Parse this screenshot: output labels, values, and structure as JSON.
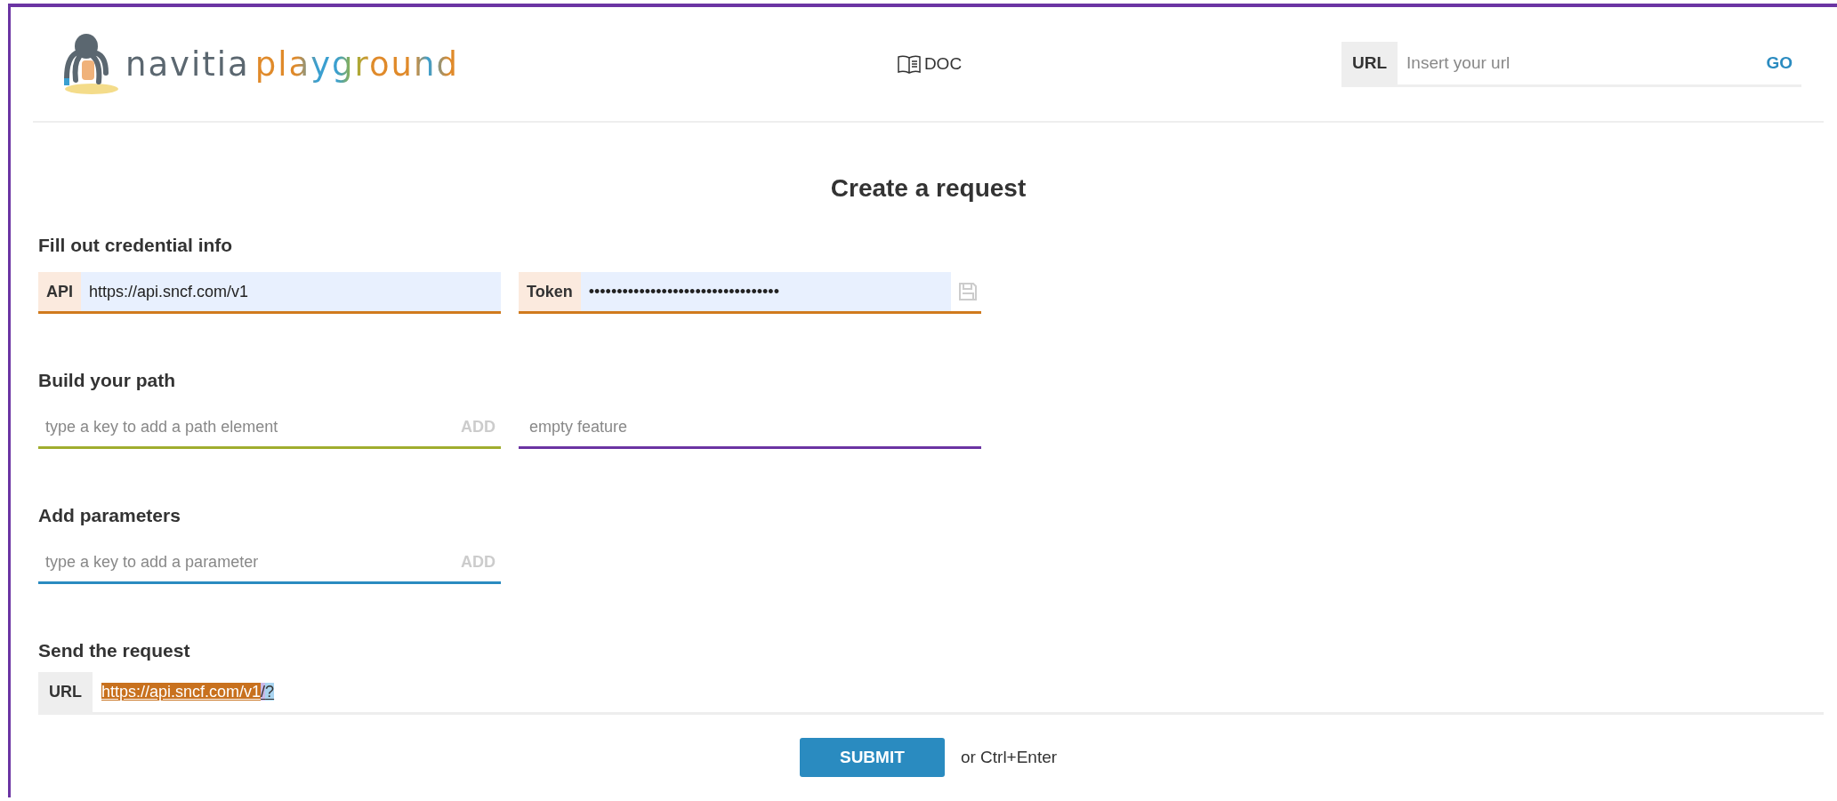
{
  "header": {
    "logo": {
      "name": "navitia",
      "accent": "playground"
    },
    "doc_link": "DOC",
    "url_bar": {
      "label": "URL",
      "placeholder": "Insert your url",
      "button": "GO"
    }
  },
  "title": "Create a request",
  "credentials": {
    "heading": "Fill out credential info",
    "api": {
      "label": "API",
      "value": "https://api.sncf.com/v1"
    },
    "token": {
      "label": "Token",
      "value": "••••••••••••••••••••••••••••••••••"
    }
  },
  "path": {
    "heading": "Build your path",
    "input": {
      "placeholder": "type a key to add a path element",
      "button": "ADD"
    },
    "feature": {
      "placeholder": "empty feature"
    }
  },
  "parameters": {
    "heading": "Add parameters",
    "input": {
      "placeholder": "type a key to add a parameter",
      "button": "ADD"
    }
  },
  "send": {
    "heading": "Send the request",
    "label": "URL",
    "url_parts": [
      {
        "kind": "api",
        "text": "https://api.sncf.com/v1",
        "color": "#c8711e"
      },
      {
        "kind": "path",
        "text": "/",
        "color": "#c9b8e8"
      },
      {
        "kind": "params",
        "text": "?",
        "color": "#a9d4f0"
      }
    ],
    "submit": "SUBMIT",
    "hint": "or Ctrl+Enter"
  }
}
